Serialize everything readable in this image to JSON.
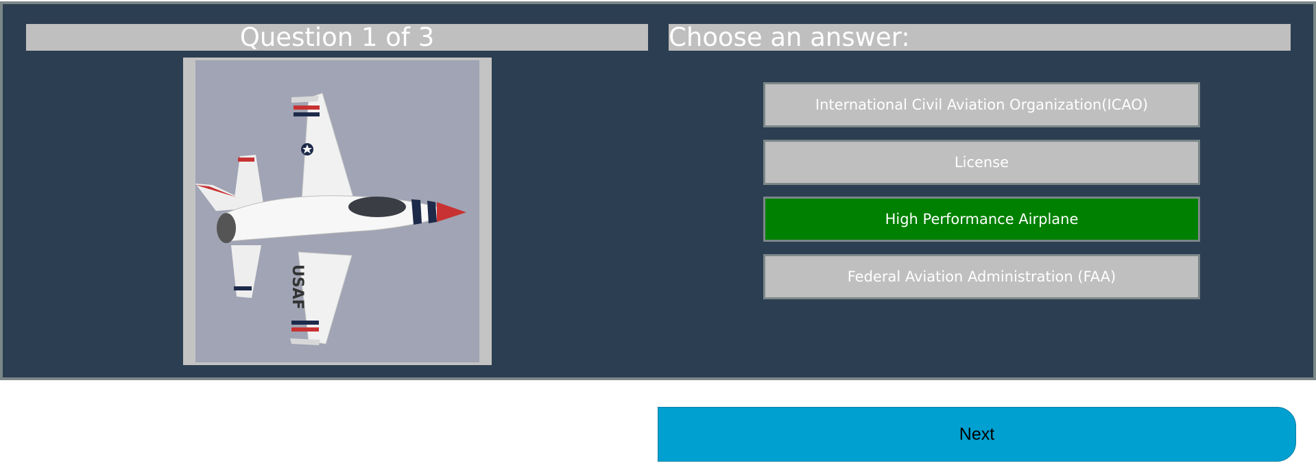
{
  "quiz": {
    "question_header": "Question 1 of 3",
    "answer_header": "Choose an answer:",
    "image": {
      "subject": "USAF fighter jet",
      "tail_text": "USAF"
    },
    "answers": [
      {
        "label": "International Civil Aviation Organization(ICAO)",
        "selected": false
      },
      {
        "label": "License",
        "selected": false
      },
      {
        "label": "High Performance Airplane",
        "selected": true
      },
      {
        "label": "Federal Aviation Administration (FAA)",
        "selected": false
      }
    ],
    "next_label": "Next"
  },
  "colors": {
    "panel_background": "#2c3e51",
    "panel_border": "#7c8789",
    "header_background": "#bfbfbf",
    "answer_default": "#bfbfbf",
    "answer_selected": "#008000",
    "next_button": "#00a0d0"
  }
}
